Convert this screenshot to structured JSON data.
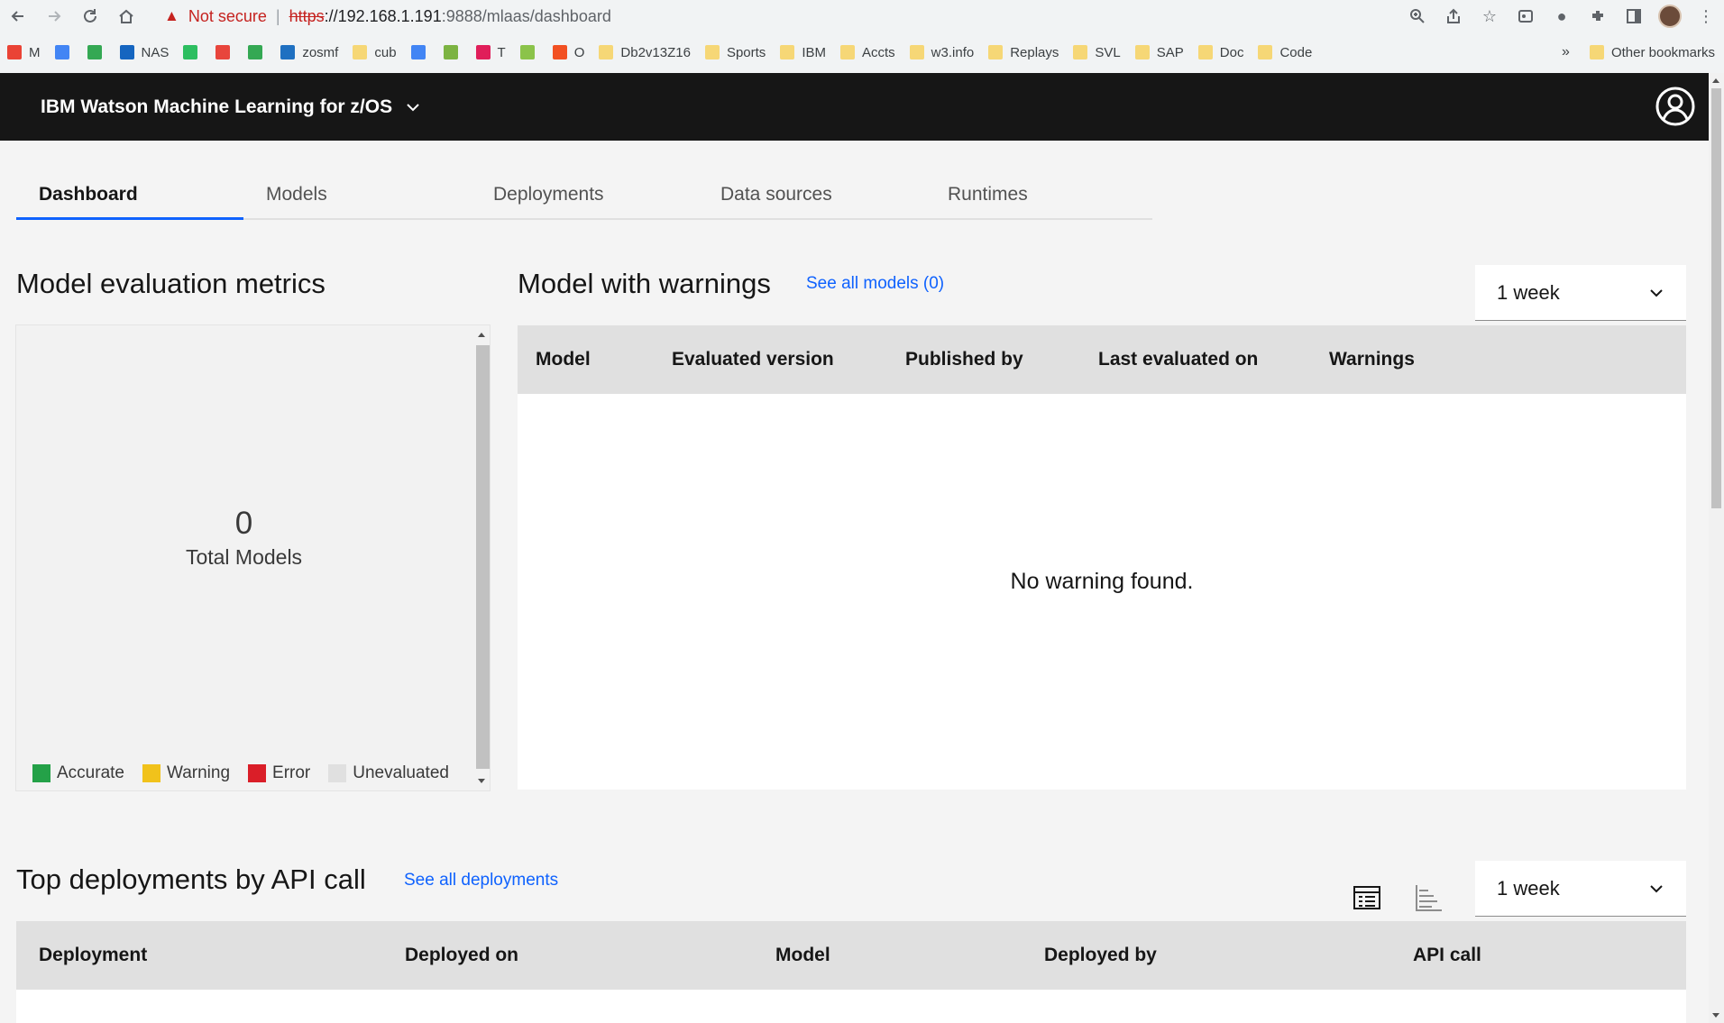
{
  "browser": {
    "not_secure": "Not secure",
    "url_scheme": "https",
    "url_host": "://192.168.1.191",
    "url_path": ":9888/mlaas/dashboard",
    "bookmarks": [
      {
        "label": "M",
        "icon": "gmail-icon",
        "color": "#ea4335"
      },
      {
        "label": "",
        "icon": "calendar-icon",
        "color": "#4285f4"
      },
      {
        "label": "",
        "icon": "drive-icon",
        "color": "#34a853"
      },
      {
        "label": "NAS",
        "icon": "dsm-icon",
        "color": "#1565c0"
      },
      {
        "label": "",
        "icon": "evernote-icon",
        "color": "#2dbe60"
      },
      {
        "label": "",
        "icon": "app-icon",
        "color": "#e8453c"
      },
      {
        "label": "",
        "icon": "maps-icon",
        "color": "#34a853"
      },
      {
        "label": "zosmf",
        "icon": "ibm-icon",
        "color": "#1f70c1"
      },
      {
        "label": "cub",
        "icon": "folder-icon",
        "color": "#f6d776"
      },
      {
        "label": "",
        "icon": "google-icon",
        "color": "#4285f4"
      },
      {
        "label": "",
        "icon": "app-icon",
        "color": "#7cb342"
      },
      {
        "label": "T",
        "icon": "slack-icon",
        "color": "#e01e5a"
      },
      {
        "label": "",
        "icon": "app-icon",
        "color": "#8bc34a"
      },
      {
        "label": "O",
        "icon": "microsoft-icon",
        "color": "#f25022"
      },
      {
        "label": "Db2v13Z16",
        "icon": "folder-icon",
        "color": "#f6d776"
      },
      {
        "label": "Sports",
        "icon": "folder-icon",
        "color": "#f6d776"
      },
      {
        "label": "IBM",
        "icon": "folder-icon",
        "color": "#f6d776"
      },
      {
        "label": "Accts",
        "icon": "folder-icon",
        "color": "#f6d776"
      },
      {
        "label": "w3.info",
        "icon": "folder-icon",
        "color": "#f6d776"
      },
      {
        "label": "Replays",
        "icon": "folder-icon",
        "color": "#f6d776"
      },
      {
        "label": "SVL",
        "icon": "folder-icon",
        "color": "#f6d776"
      },
      {
        "label": "SAP",
        "icon": "folder-icon",
        "color": "#f6d776"
      },
      {
        "label": "Doc",
        "icon": "folder-icon",
        "color": "#f6d776"
      },
      {
        "label": "Code",
        "icon": "folder-icon",
        "color": "#f6d776"
      }
    ],
    "more": "»",
    "other_bookmarks": "Other bookmarks"
  },
  "app": {
    "title": "IBM Watson Machine Learning for z/OS"
  },
  "tabs": [
    {
      "label": "Dashboard",
      "active": true
    },
    {
      "label": "Models",
      "active": false
    },
    {
      "label": "Deployments",
      "active": false
    },
    {
      "label": "Data sources",
      "active": false
    },
    {
      "label": "Runtimes",
      "active": false
    }
  ],
  "metrics": {
    "heading": "Model evaluation metrics",
    "total_value": "0",
    "total_label": "Total Models",
    "legend": [
      {
        "label": "Accurate",
        "color": "#24a148"
      },
      {
        "label": "Warning",
        "color": "#f1c21b"
      },
      {
        "label": "Error",
        "color": "#da1e28"
      },
      {
        "label": "Unevaluated",
        "color": "#e0e0e0"
      }
    ]
  },
  "warnings": {
    "heading": "Model with warnings",
    "see_all": "See all models (0)",
    "period": "1 week",
    "columns": [
      "Model",
      "Evaluated version",
      "Published by",
      "Last evaluated on",
      "Warnings"
    ],
    "empty_message": "No warning found."
  },
  "deployments": {
    "heading": "Top deployments by API call",
    "see_all": "See all deployments",
    "period": "1 week",
    "columns": [
      "Deployment",
      "Deployed on",
      "Model",
      "Deployed by",
      "API call"
    ]
  },
  "colors": {
    "accent": "#0f62fe",
    "header_bg": "#161616",
    "link": "#0f62fe"
  }
}
